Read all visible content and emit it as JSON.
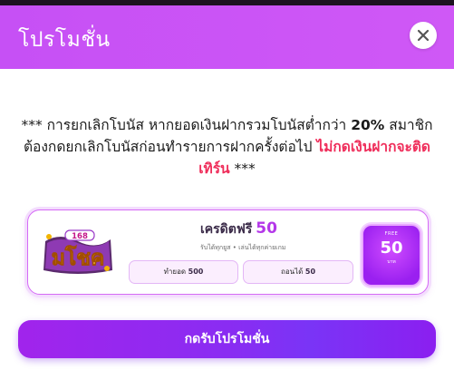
{
  "header": {
    "title": "โปรโมชั่น"
  },
  "notice": {
    "prefix": "*** การยกเลิกโบนัส หากยอดเงินฝากรวมโบนัสต่ำกว่า ",
    "percent": "20%",
    "middle": " สมาชิกต้องกดยกเลิกโบนัสก่อนทำรายการฝากครั้งต่อไป ",
    "warning": "ไม่กดเงินฝากจะติดเทิร์น",
    "suffix": " ***"
  },
  "promo": {
    "logo_text": "มโชค",
    "logo_badge": "168",
    "title": "เครดิตฟรี",
    "title_value": "50",
    "subtitle": "รับได้ทุกยูส • เล่นได้ทุกค่ายเกม",
    "turnover_label": "ทำยอด",
    "turnover_value": "500",
    "withdraw_label": "ถอนได้",
    "withdraw_value": "50",
    "free_label": "FREE",
    "free_amount": "50",
    "free_unit": "บาท"
  },
  "actions": {
    "claim_label": "กดรับโปรโมชั่น"
  },
  "colors": {
    "header": "#cb55f6",
    "accent_red": "#ef2d5a",
    "accent_purple": "#b437e9",
    "button": "#8a2cf2"
  }
}
